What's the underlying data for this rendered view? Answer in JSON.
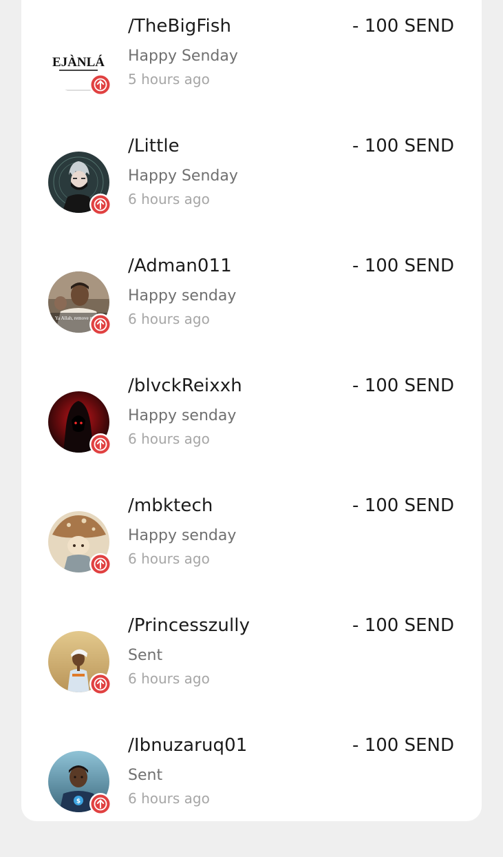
{
  "transactions": [
    {
      "name": "/TheBigFish",
      "memo": "Happy Senday",
      "time": "5 hours ago",
      "amount": "- 100 SEND",
      "avatar_icon": "ejanla-logo",
      "avatar_logo_text": "EJÀNLÁ",
      "direction_icon": "arrow-up-icon"
    },
    {
      "name": "/Little",
      "memo": "Happy Senday",
      "time": "6 hours ago",
      "amount": "- 100 SEND",
      "avatar_icon": "masked-anime-character",
      "direction_icon": "arrow-up-icon"
    },
    {
      "name": "/Adman011",
      "memo": "Happy senday",
      "time": "6 hours ago",
      "amount": "- 100 SEND",
      "avatar_icon": "man-photo-with-caption",
      "avatar_caption": "Ya Allah, remove my diffic",
      "direction_icon": "arrow-up-icon"
    },
    {
      "name": "/blvckReixxh",
      "memo": "Happy senday",
      "time": "6 hours ago",
      "amount": "- 100 SEND",
      "avatar_icon": "hooded-figure-red",
      "direction_icon": "arrow-up-icon"
    },
    {
      "name": "/mbktech",
      "memo": "Happy senday",
      "time": "6 hours ago",
      "amount": "- 100 SEND",
      "avatar_icon": "mushroom-hat-child",
      "direction_icon": "arrow-up-icon"
    },
    {
      "name": "/Princesszully",
      "memo": "Sent",
      "time": "6 hours ago",
      "amount": "- 100 SEND",
      "avatar_icon": "woman-headscarf-photo",
      "direction_icon": "arrow-up-icon"
    },
    {
      "name": "/Ibnuzaruq01",
      "memo": "Sent",
      "time": "6 hours ago",
      "amount": "- 100 SEND",
      "avatar_icon": "cartoon-man-coin",
      "direction_icon": "arrow-up-icon"
    }
  ],
  "colors": {
    "badge": "#e04141",
    "name": "#1b1b1b",
    "memo": "#707070",
    "time": "#a6a6a6"
  }
}
